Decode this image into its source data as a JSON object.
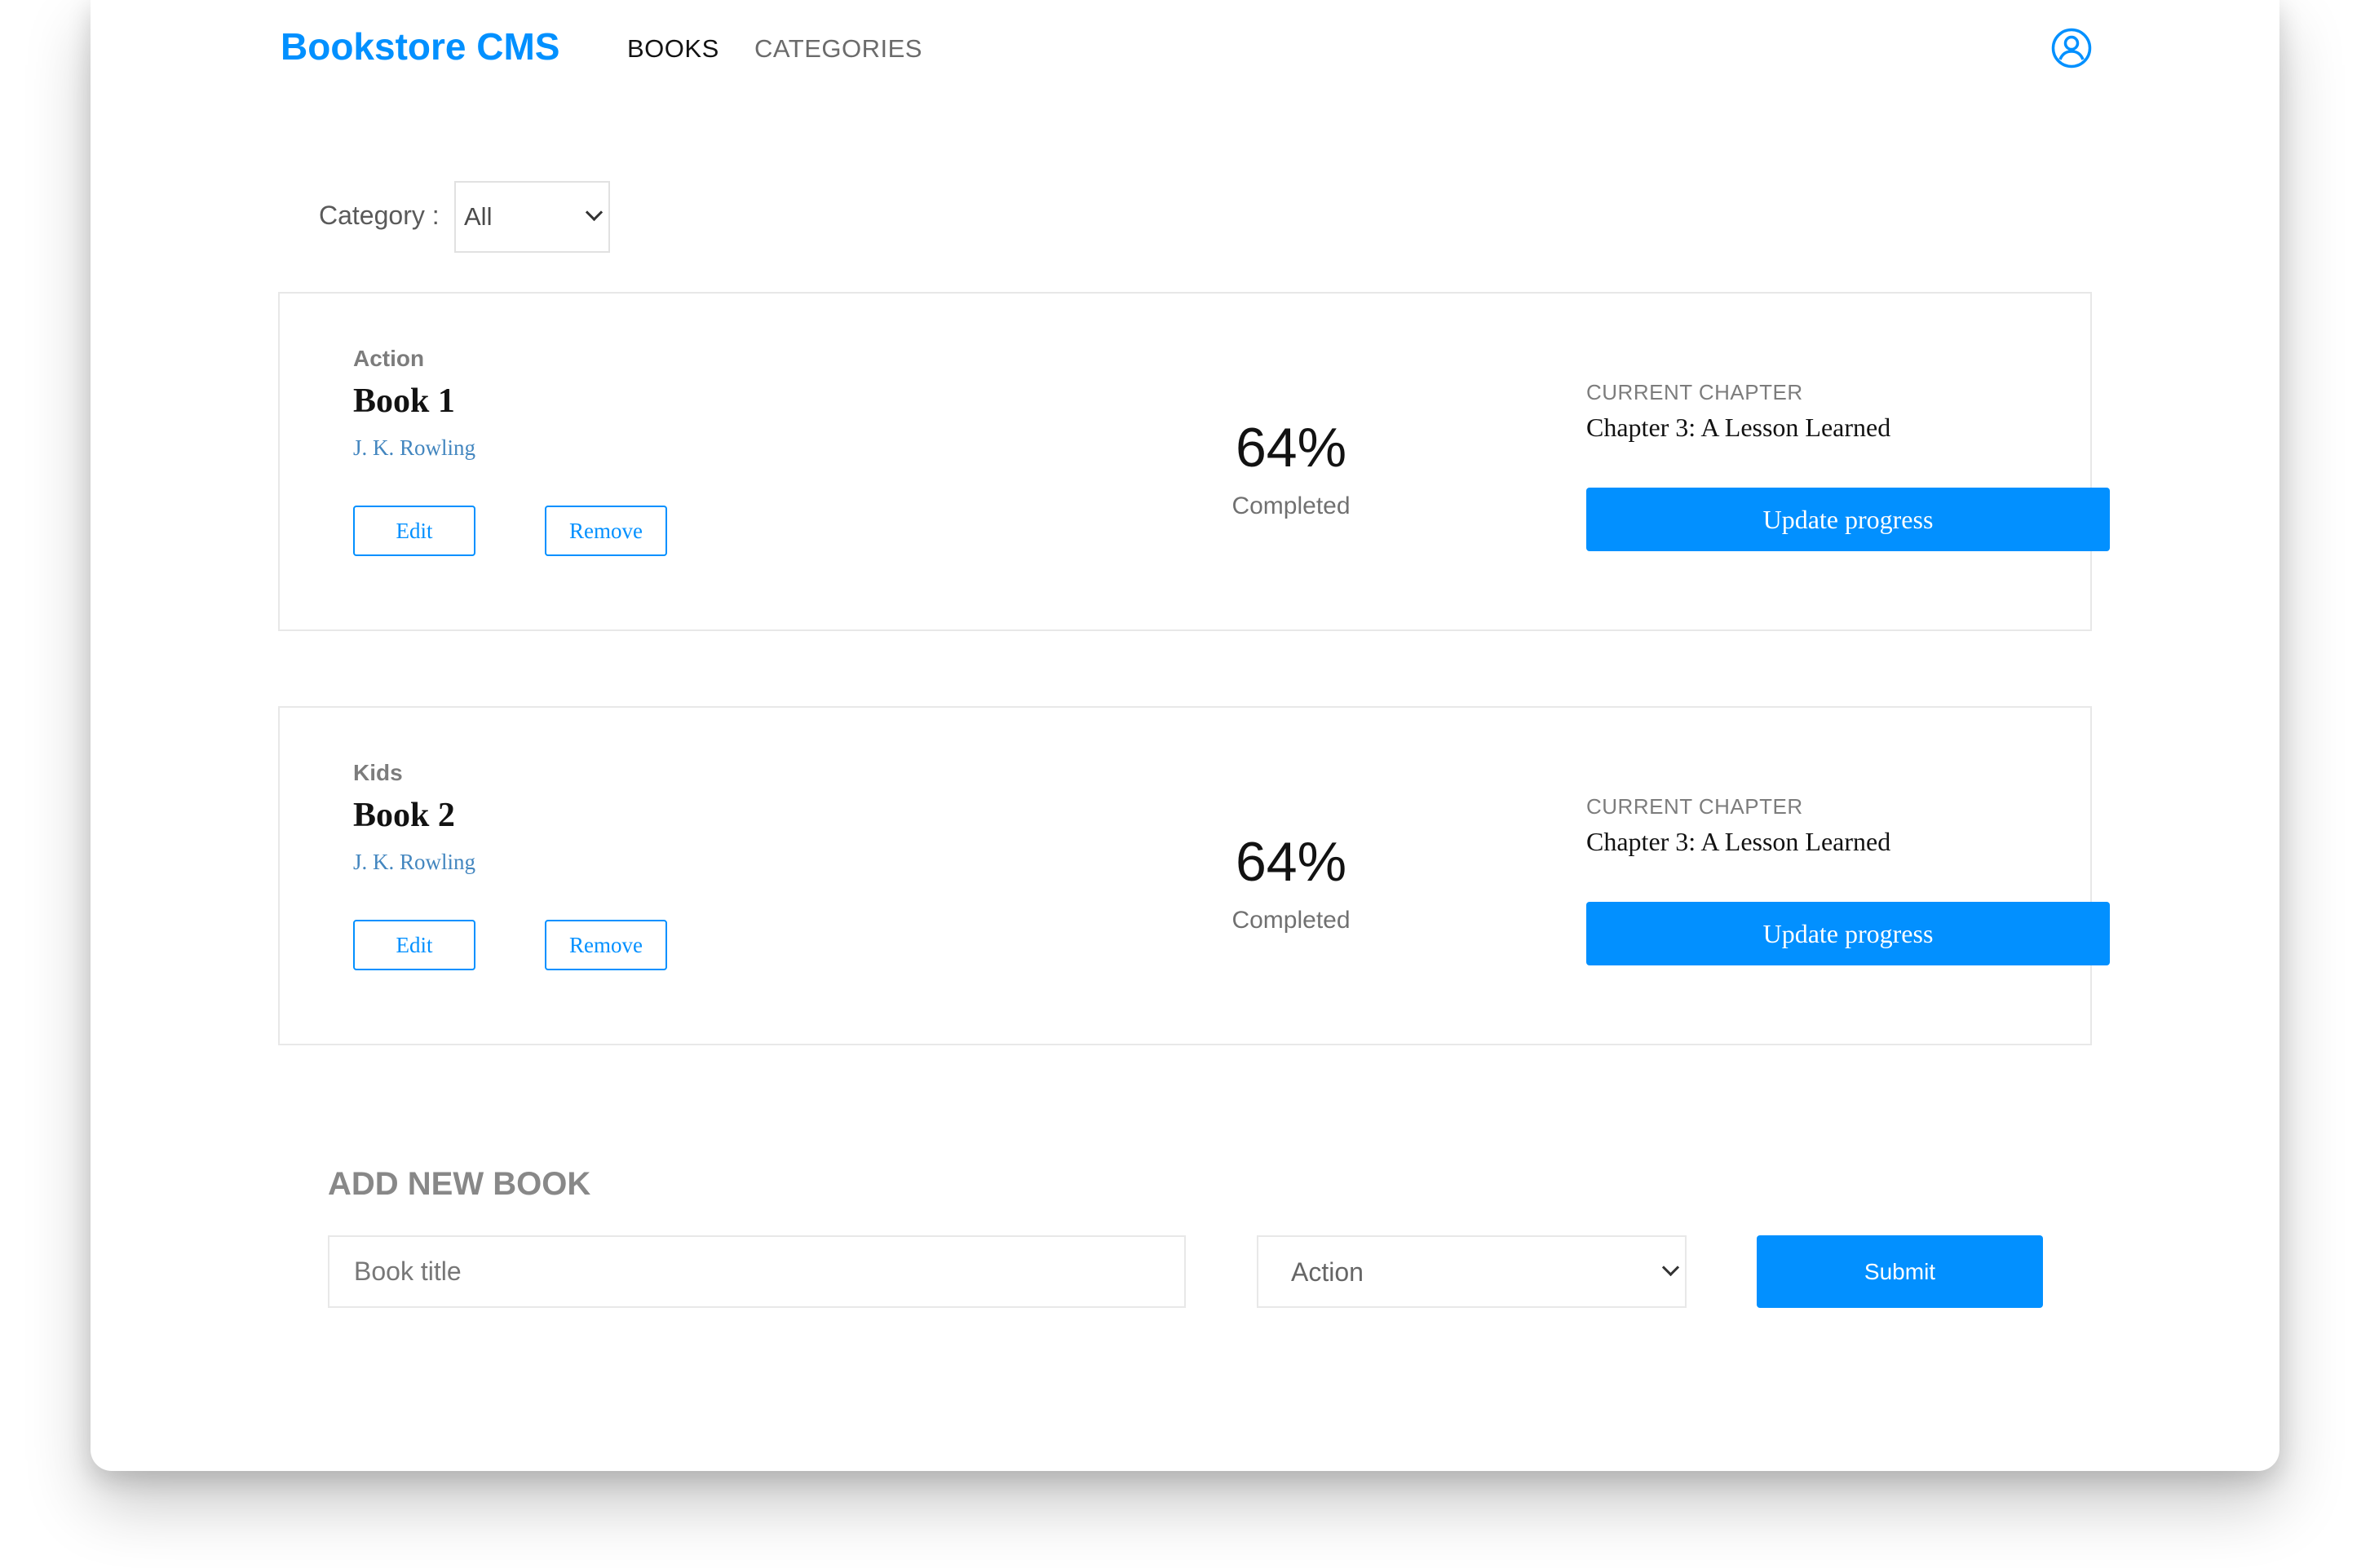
{
  "header": {
    "brand": "Bookstore CMS",
    "nav": [
      {
        "label": "BOOKS",
        "active": true
      },
      {
        "label": "CATEGORIES",
        "active": false
      }
    ],
    "user_icon": "user-circle-icon"
  },
  "filter": {
    "label": "Category :",
    "selected": "All"
  },
  "books": [
    {
      "category": "Action",
      "title": "Book 1",
      "author": "J. K. Rowling",
      "edit_label": "Edit",
      "remove_label": "Remove",
      "percent": "64%",
      "completed_label": "Completed",
      "chapter_label": "CURRENT CHAPTER",
      "chapter": "Chapter 3: A Lesson Learned",
      "update_label": "Update progress"
    },
    {
      "category": "Kids",
      "title": "Book 2",
      "author": "J. K. Rowling",
      "edit_label": "Edit",
      "remove_label": "Remove",
      "percent": "64%",
      "completed_label": "Completed",
      "chapter_label": "CURRENT CHAPTER",
      "chapter": "Chapter 3: A Lesson Learned",
      "update_label": "Update progress"
    }
  ],
  "add_form": {
    "title": "ADD NEW BOOK",
    "title_placeholder": "Book title",
    "title_value": "",
    "category_selected": "Action",
    "submit_label": "Submit"
  },
  "colors": {
    "accent": "#0290ff",
    "author": "#4386bf",
    "text": "#121212",
    "border": "#e8e8e8"
  }
}
